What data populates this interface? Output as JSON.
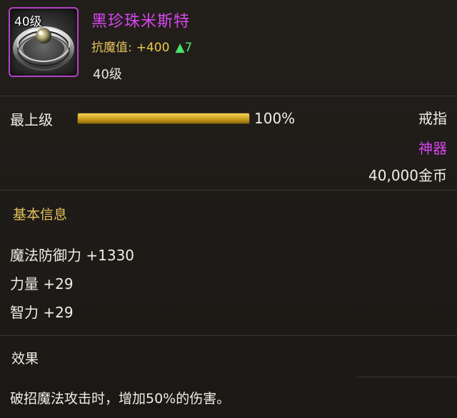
{
  "item": {
    "icon_level": "40级",
    "name": "黑珍珠米斯特",
    "stat_label": "抗魔值:",
    "stat_value": "+400",
    "stat_delta": "▲7",
    "required_level": "40级"
  },
  "progress": {
    "label": "最上级",
    "percent_text": "100%",
    "fill_fraction": 1.0
  },
  "meta": {
    "slot": "戒指",
    "rarity": "神器",
    "price": "40,000金币"
  },
  "basic_info": {
    "title": "基本信息",
    "attributes": [
      "魔法防御力 +1330",
      "力量 +29",
      "智力 +29"
    ]
  },
  "effect": {
    "title": "效果",
    "text": "破招魔法攻击时，增加50%的伤害。"
  },
  "colors": {
    "name_color": "#d946ef",
    "rarity_color": "#d946ef",
    "section_title_color": "#e6c25a",
    "stat_up_color": "#4ee26a",
    "bar_fill_color": "#e0b52c"
  }
}
